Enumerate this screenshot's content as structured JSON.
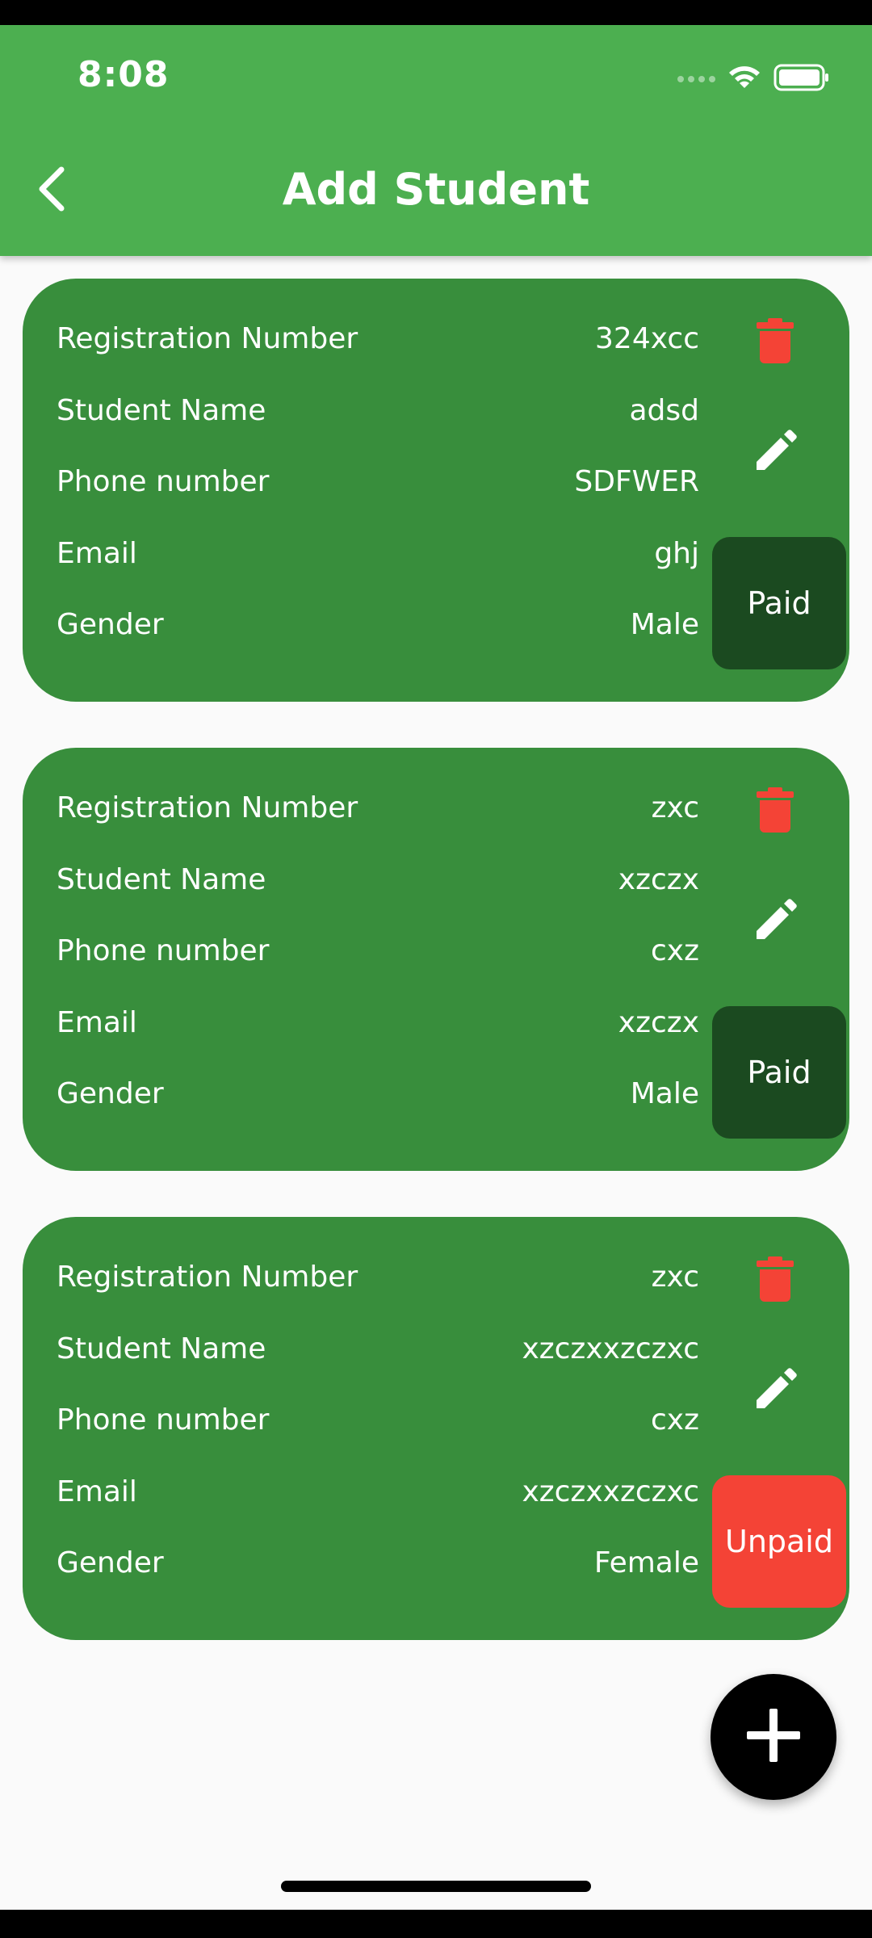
{
  "status_bar": {
    "time": "8:08"
  },
  "app_bar": {
    "title": "Add Student"
  },
  "students": [
    {
      "registration_label": "Registration Number",
      "registration_value": "324xcc",
      "name_label": "Student Name",
      "name_value": "adsd",
      "phone_label": "Phone number",
      "phone_value": "SDFWER",
      "email_label": "Email",
      "email_value": "ghj",
      "gender_label": "Gender",
      "gender_value": "Male",
      "status_label": "Paid"
    },
    {
      "registration_label": "Registration Number",
      "registration_value": "zxc",
      "name_label": "Student Name",
      "name_value": "xzczx",
      "phone_label": "Phone number",
      "phone_value": "cxz",
      "email_label": "Email",
      "email_value": "xzczx",
      "gender_label": "Gender",
      "gender_value": "Male",
      "status_label": "Paid"
    },
    {
      "registration_label": "Registration Number",
      "registration_value": "zxc",
      "name_label": "Student Name",
      "name_value": "xzczxxzczxc",
      "phone_label": "Phone number",
      "phone_value": "cxz",
      "email_label": "Email",
      "email_value": "xzczxxzczxc",
      "gender_label": "Gender",
      "gender_value": "Female",
      "status_label": "Unpaid"
    }
  ],
  "icons": {
    "back": "chevron-left-icon",
    "delete": "trash-icon",
    "edit": "pencil-icon",
    "add": "plus-icon",
    "wifi": "wifi-icon",
    "battery": "battery-icon"
  },
  "colors": {
    "app_bar": "#4CAF50",
    "card": "#388E3C",
    "paid_button": "#1B4A20",
    "unpaid_button": "#F44336",
    "delete_icon": "#F44336",
    "fab": "#000000",
    "background": "#FAFAFA"
  }
}
